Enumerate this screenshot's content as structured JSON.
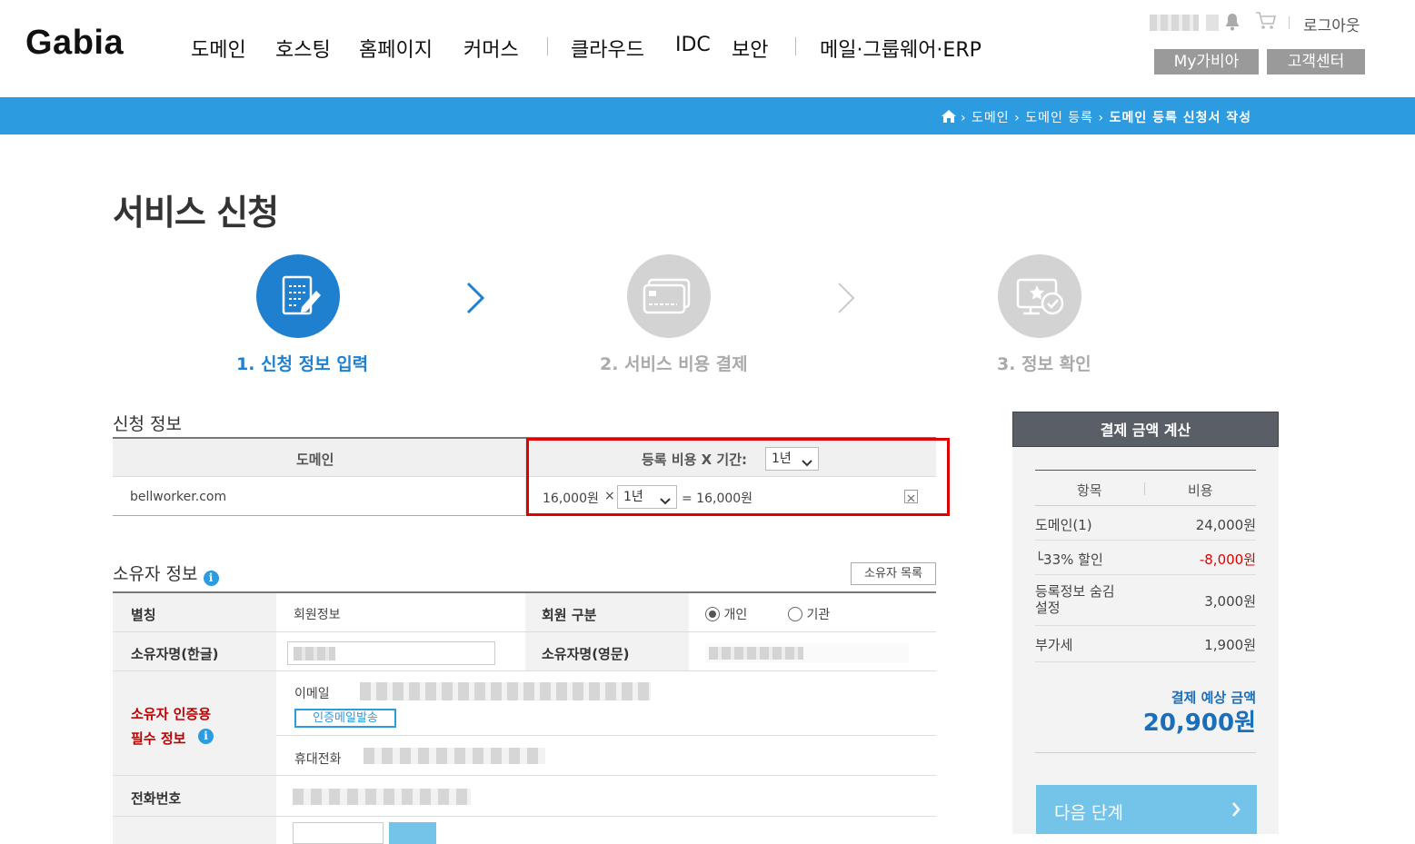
{
  "header": {
    "logo": "Gabia",
    "nav": [
      "도메인",
      "호스팅",
      "홈페이지",
      "커머스",
      "클라우드",
      "IDC",
      "보안",
      "메일·그룹웨어·ERP"
    ],
    "logout": "로그아웃",
    "my_button": "My가비아",
    "support_button": "고객센터"
  },
  "breadcrumb": {
    "items": [
      "도메인",
      "도메인 등록"
    ],
    "current": "도메인 등록 신청서 작성"
  },
  "page_title": "서비스 신청",
  "steps": [
    {
      "label": "1. 신청 정보 입력",
      "active": true
    },
    {
      "label": "2. 서비스 비용 결제",
      "active": false
    },
    {
      "label": "3. 정보 확인",
      "active": false
    }
  ],
  "application": {
    "section_title": "신청 정보",
    "col_domain": "도메인",
    "col_fee": "등록 비용 X 기간:",
    "period_header": "1년",
    "domain": "bellworker.com",
    "unit_price": "16,000원",
    "times": "×",
    "period": "1년",
    "equals": "= 16,000원"
  },
  "owner": {
    "section_title": "소유자 정보",
    "list_button": "소유자 목록",
    "alias_label": "별칭",
    "alias_value": "회원정보",
    "member_type_label": "회원 구분",
    "type_personal": "개인",
    "type_org": "기관",
    "name_kr_label": "소유자명(한글)",
    "name_en_label": "소유자명(영문)",
    "cert_label_line1": "소유자 인증용",
    "cert_label_line2": "필수 정보",
    "email_label": "이메일",
    "send_mail_button": "인증메일발송",
    "mobile_label": "휴대전화",
    "phone_label": "전화번호"
  },
  "summary": {
    "title": "결제 금액 계산",
    "col_item": "항목",
    "col_cost": "비용",
    "rows": [
      {
        "item": "도메인(1)",
        "cost": "24,000원"
      },
      {
        "item": "└33% 할인",
        "cost": "-8,000원"
      },
      {
        "item": "등록정보 숨김 설정",
        "cost": "3,000원"
      },
      {
        "item": "부가세",
        "cost": "1,900원"
      }
    ],
    "total_label": "결제 예상 금액",
    "total_value": "20,900원",
    "next_button": "다음 단계"
  },
  "colors": {
    "brand_blue": "#2c9be0",
    "highlight_red": "#e00000",
    "discount_red": "#e00000",
    "total_blue": "#1a6fba"
  }
}
